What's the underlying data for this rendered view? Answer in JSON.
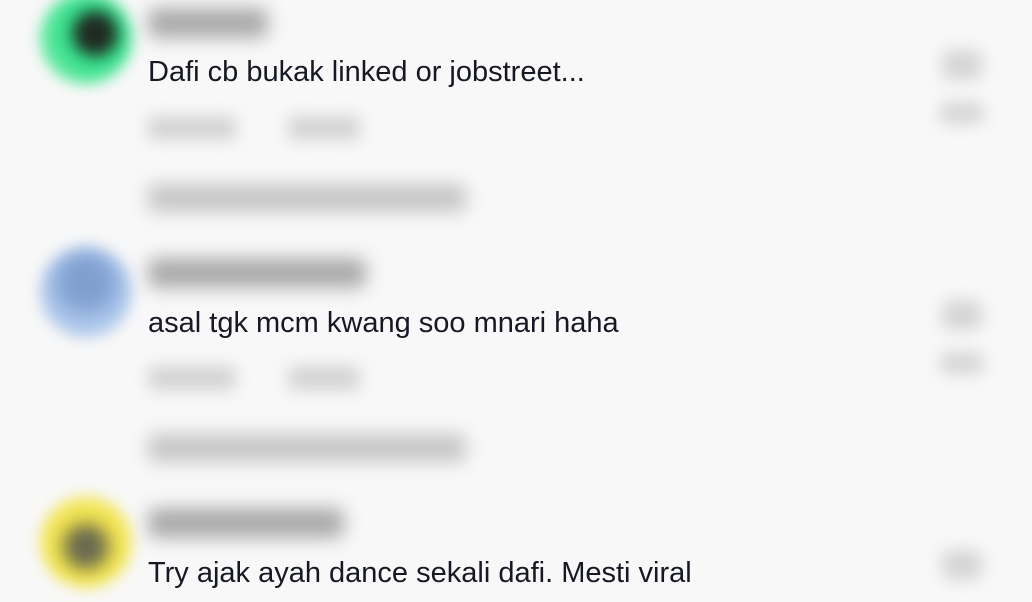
{
  "comments": [
    {
      "text": "Dafi cb bukak linked or jobstreet...",
      "avatar_color": "#33e08a"
    },
    {
      "text": "asal tgk mcm kwang soo mnari haha",
      "avatar_color": "#a9c4ea"
    },
    {
      "text": "Try ajak ayah dance sekali dafi. Mesti viral",
      "avatar_color": "#f1e34b"
    }
  ]
}
